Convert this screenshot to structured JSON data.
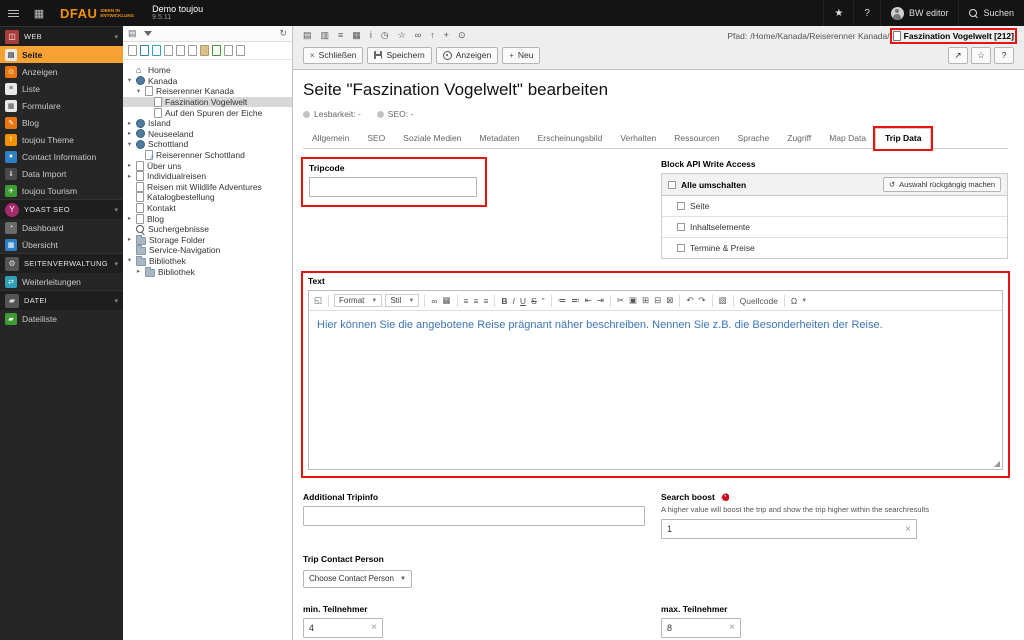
{
  "topbar": {
    "logo_text": "DFAU",
    "logo_sub1": "IDEEN IN",
    "logo_sub2": "ENTWICKLUNG",
    "site_name": "Demo toujou",
    "site_version": "9.5.11",
    "username": "BW editor",
    "search_label": "Suchen"
  },
  "module_menu": {
    "sections": [
      {
        "label": "WEB",
        "items": [
          {
            "label": "Seite"
          },
          {
            "label": "Anzeigen"
          },
          {
            "label": "Liste"
          },
          {
            "label": "Formulare"
          },
          {
            "label": "Blog"
          },
          {
            "label": "toujou Theme"
          },
          {
            "label": "Contact Information"
          },
          {
            "label": "Data Import"
          },
          {
            "label": "toujou Tourism"
          }
        ]
      },
      {
        "label": "YOAST SEO",
        "items": [
          {
            "label": "Dashboard"
          },
          {
            "label": "Übersicht"
          }
        ]
      },
      {
        "label": "SEITENVERWALTUNG",
        "items": [
          {
            "label": "Weiterleitungen"
          }
        ]
      },
      {
        "label": "DATEI",
        "items": [
          {
            "label": "Dateiliste"
          }
        ]
      }
    ]
  },
  "pagetree": {
    "nodes": [
      {
        "label": "Home"
      },
      {
        "label": "Kanada"
      },
      {
        "label": "Reiserenner Kanada"
      },
      {
        "label": "Faszination Vogelwelt"
      },
      {
        "label": "Auf den Spuren der Eiche"
      },
      {
        "label": "Island"
      },
      {
        "label": "Neuseeland"
      },
      {
        "label": "Schottland"
      },
      {
        "label": "Reiserenner Schottland"
      },
      {
        "label": "Über uns"
      },
      {
        "label": "Individualreisen"
      },
      {
        "label": "Reisen mit Wildlife Adventures"
      },
      {
        "label": "Katalogbestellung"
      },
      {
        "label": "Kontakt"
      },
      {
        "label": "Blog"
      },
      {
        "label": "Suchergebnisse"
      },
      {
        "label": "Storage Folder"
      },
      {
        "label": "Service-Navigation"
      },
      {
        "label": "Bibliothek"
      },
      {
        "label": "Bibliothek"
      }
    ]
  },
  "docheader": {
    "path_label": "Pfad:",
    "path_value": "/Home/Kanada/Reiserenner Kanada/",
    "record_title": "Faszination Vogelwelt [212]",
    "btn_close": "Schließen",
    "btn_save": "Speichern",
    "btn_view": "Anzeigen",
    "btn_new": "Neu"
  },
  "page": {
    "title": "Seite \"Faszination Vogelwelt\" bearbeiten",
    "badge_readability": "Lesbarkeit: -",
    "badge_seo": "SEO: -",
    "tabs": [
      {
        "label": "Allgemein"
      },
      {
        "label": "SEO"
      },
      {
        "label": "Soziale Medien"
      },
      {
        "label": "Metadaten"
      },
      {
        "label": "Erscheinungsbild"
      },
      {
        "label": "Verhalten"
      },
      {
        "label": "Ressourcen"
      },
      {
        "label": "Sprache"
      },
      {
        "label": "Zugriff"
      },
      {
        "label": "Map Data"
      },
      {
        "label": "Trip Data"
      }
    ]
  },
  "form": {
    "tripcode_label": "Tripcode",
    "tripcode_value": "",
    "blockapi_label": "Block API Write Access",
    "blockapi_toggle_all": "Alle umschalten",
    "blockapi_undo_button": "Auswahl rückgängig machen",
    "blockapi_options": [
      {
        "label": "Seite"
      },
      {
        "label": "Inhaltselemente"
      },
      {
        "label": "Termine & Preise"
      }
    ],
    "text_label": "Text",
    "text_format": "Format",
    "text_style": "Stil",
    "text_source": "Quellcode",
    "text_value": "Hier können Sie die angebotene Reise prägnant näher beschreiben. Nennen Sie z.B. die Besonderheiten der Reise.",
    "tripinfo_label": "Additional Tripinfo",
    "tripinfo_value": "",
    "boost_label": "Search boost",
    "boost_help": "A higher value will boost the trip and show the trip higher within the searchresults",
    "boost_value": "1",
    "contact_label": "Trip Contact Person",
    "contact_value": "Choose Contact Person",
    "min_label": "min. Teilnehmer",
    "min_value": "4",
    "max_label": "max. Teilnehmer",
    "max_value": "8"
  },
  "colors": {
    "accent_orange": "#f39200",
    "annotation_red": "#e8130e",
    "rte_text_blue": "#3e76bb"
  }
}
